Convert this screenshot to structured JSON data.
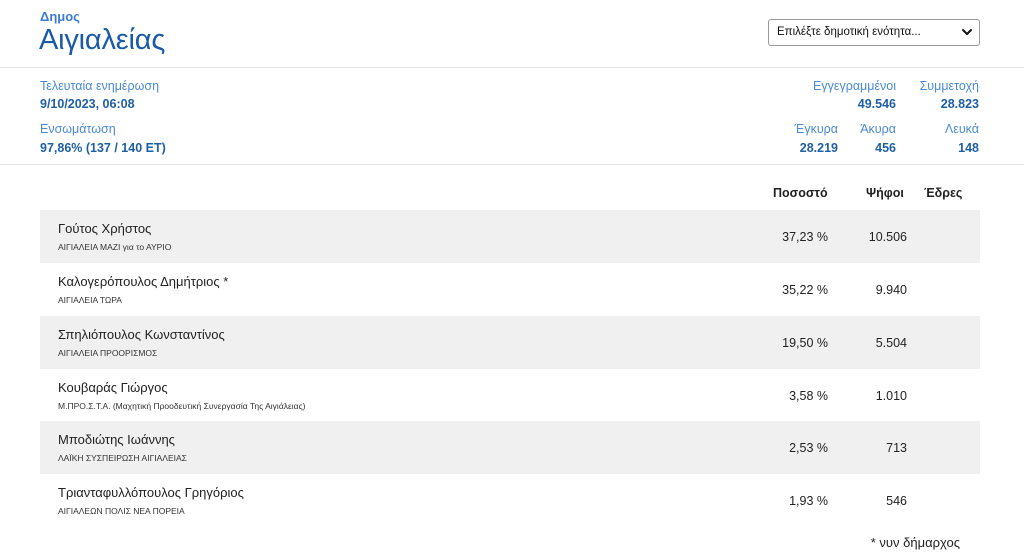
{
  "header": {
    "kicker": "Δημος",
    "title": "Αιγιαλείας",
    "select_value": "Επιλέξτε δημοτική ενότητα..."
  },
  "stats": {
    "update_label": "Τελευταία ενημέρωση",
    "update_value": "9/10/2023, 06:08",
    "integration_label": "Ενσωμάτωση",
    "integration_value": "97,86% (137 / 140 ΕΤ)",
    "registered_label": "Εγγεγραμμένοι",
    "registered_value": "49.546",
    "turnout_label": "Συμμετοχή",
    "turnout_value": "28.823",
    "valid_label": "Έγκυρα",
    "valid_value": "28.219",
    "invalid_label": "Άκυρα",
    "invalid_value": "456",
    "blank_label": "Λευκά",
    "blank_value": "148"
  },
  "table": {
    "col_percent": "Ποσοστό",
    "col_votes": "Ψήφοι",
    "col_seats": "Έδρες",
    "rows": [
      {
        "name": "Γούτος Χρήστος",
        "party": "ΑΙΓΙΑΛΕΙΑ ΜΑΖΙ για το ΑΥΡΙΟ",
        "percent": "37,23 %",
        "votes": "10.506"
      },
      {
        "name": "Καλογερόπουλος Δημήτριος *",
        "party": "ΑΙΓΙΑΛΕΙΑ ΤΩΡΑ",
        "percent": "35,22 %",
        "votes": "9.940"
      },
      {
        "name": "Σπηλιόπουλος Κωνσταντίνος",
        "party": "ΑΙΓΙΑΛΕΙΑ ΠΡΟΟΡΙΣΜΟΣ",
        "percent": "19,50 %",
        "votes": "5.504"
      },
      {
        "name": "Κουβαράς Γιώργος",
        "party": "Μ.ΠΡΟ.Σ.Τ.Α. (Μαχητική Προοδευτική Συνεργασία Της Αιγιάλειας)",
        "percent": "3,58 %",
        "votes": "1.010"
      },
      {
        "name": "Μποδιώτης Ιωάννης",
        "party": "ΛΑΪΚΗ ΣΥΣΠΕΙΡΩΣΗ ΑΙΓΙΑΛΕΙΑΣ",
        "percent": "2,53 %",
        "votes": "713"
      },
      {
        "name": "Τριανταφυλλόπουλος Γρηγόριος",
        "party": "ΑΙΓΙΑΛΕΩΝ ΠΟΛΙΣ ΝΕΑ ΠΟΡΕΙΑ",
        "percent": "1,93 %",
        "votes": "546"
      }
    ]
  },
  "footnote": "* νυν δήμαρχος",
  "colors": {
    "accent": "#1a5aa8",
    "label_blue": "#4a8ad6",
    "row_shade": "#f0f0f0"
  },
  "icons": {
    "select_chevron": "chevron-down-icon"
  }
}
